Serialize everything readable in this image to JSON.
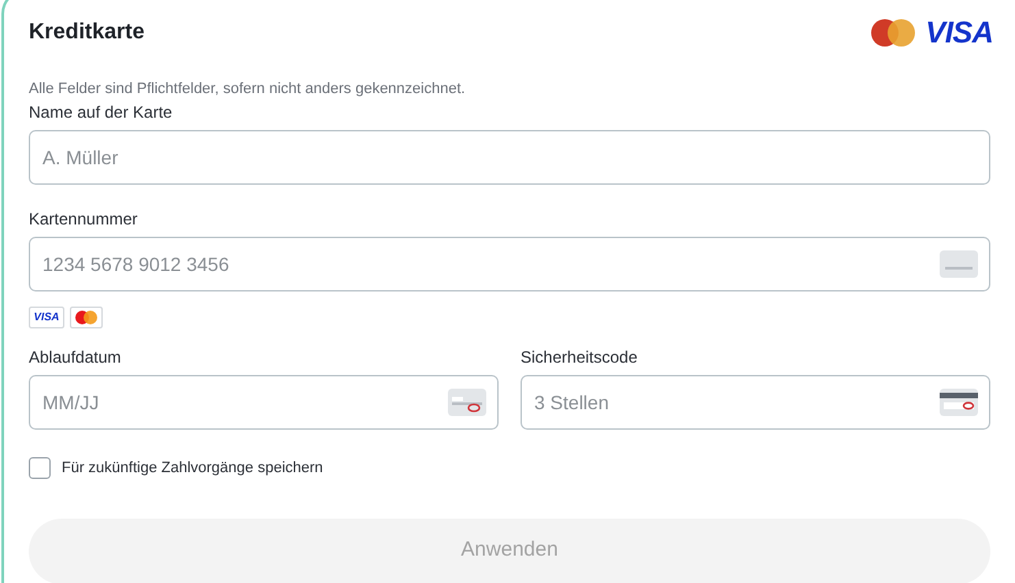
{
  "title": "Kreditkarte",
  "header_logos": {
    "visa": "VISA"
  },
  "note": "Alle Felder sind Pflichtfelder, sofern nicht anders gekennzeichnet.",
  "fields": [
    {
      "label": "Name auf der Karte",
      "placeholder": "A. Müller",
      "kind": "text"
    },
    {
      "label": "Kartennummer",
      "placeholder": "1234 5678 9012 3456",
      "kind": "card"
    }
  ],
  "brand_badges": [
    {
      "kind": "visa",
      "text": "VISA"
    },
    {
      "kind": "mastercard"
    }
  ],
  "half_fields": [
    {
      "label": "Ablaufdatum",
      "placeholder": "MM/JJ",
      "kind": "expiry"
    },
    {
      "label": "Sicherheitscode",
      "placeholder": "3 Stellen",
      "kind": "cvc"
    }
  ],
  "save_option": {
    "label": "Für zukünftige Zahlvorgänge speichern",
    "checked": false
  },
  "submit": {
    "label": "Anwenden",
    "disabled": true
  }
}
